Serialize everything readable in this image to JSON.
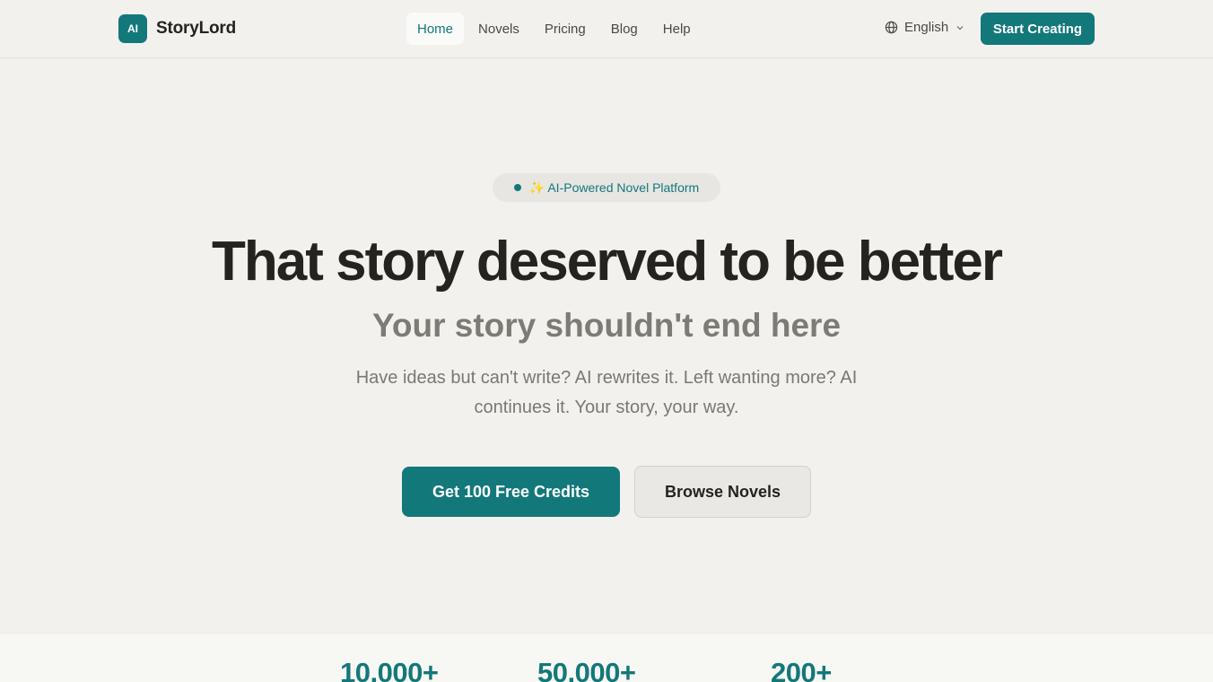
{
  "brand": {
    "logo_text": "AI",
    "name": "StoryLord"
  },
  "nav": {
    "items": [
      {
        "label": "Home",
        "active": true
      },
      {
        "label": "Novels"
      },
      {
        "label": "Pricing"
      },
      {
        "label": "Blog"
      },
      {
        "label": "Help"
      }
    ]
  },
  "language": {
    "label": "English",
    "icon": "globe-icon",
    "caret_icon": "chevron-down-icon"
  },
  "header_cta": "Start Creating",
  "hero": {
    "badge": "✨ AI-Powered Novel Platform",
    "title": "That story deserved to be better",
    "subtitle": "Your story shouldn't end here",
    "description": "Have ideas but can't write? AI rewrites it. Left wanting more? AI continues it. Your story, your way.",
    "primary_cta": "Get 100 Free Credits",
    "secondary_cta": "Browse Novels"
  },
  "stats": [
    {
      "value": "10,000+"
    },
    {
      "value": "50,000+"
    },
    {
      "value": "200+"
    }
  ],
  "colors": {
    "accent": "#13787a",
    "background": "#f2f1ee",
    "text": "#24231f",
    "muted": "#7d7b74"
  }
}
